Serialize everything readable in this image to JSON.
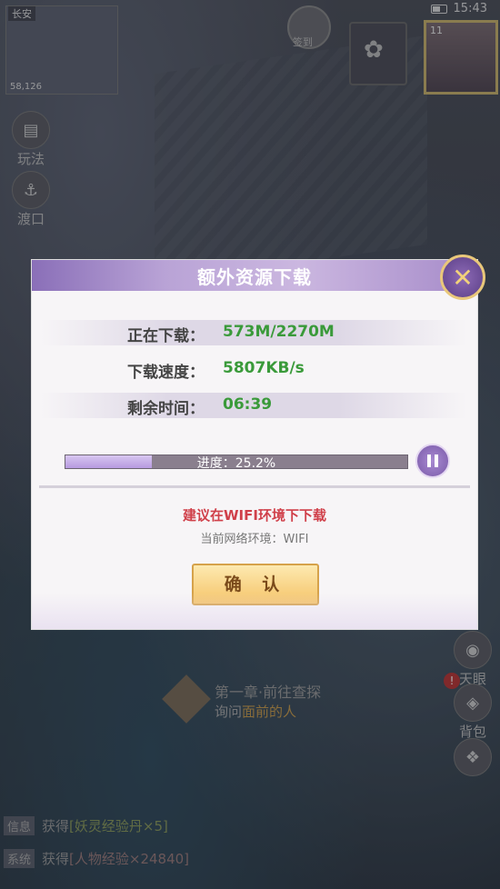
{
  "status_bar": {
    "time": "15:43"
  },
  "minimap": {
    "location": "长安",
    "coords": "58,126"
  },
  "player": {
    "level": "11"
  },
  "top_icons": {
    "event_label": "签到"
  },
  "side_buttons": [
    {
      "label": "玩法",
      "icon": "scroll-icon"
    },
    {
      "label": "渡口",
      "icon": "boat-icon"
    }
  ],
  "right_buttons": [
    {
      "label": "天眼",
      "icon": "eye-icon"
    },
    {
      "label": "背包",
      "icon": "bag-icon"
    }
  ],
  "quest": {
    "title": "第一章·前往查探",
    "sub_prefix": "询问",
    "sub_highlight": "面前的人"
  },
  "chat": [
    {
      "tag": "信息",
      "prefix": "获得",
      "item": "[妖灵经验丹×5]"
    },
    {
      "tag": "系统",
      "prefix": "获得",
      "item": "[人物经验×24840]"
    }
  ],
  "dialog": {
    "title": "额外资源下载",
    "rows": [
      {
        "label": "正在下载：",
        "value": "573M/2270M"
      },
      {
        "label": "下载速度：",
        "value": "5807KB/s"
      },
      {
        "label": "剩余时间：",
        "value": "06:39"
      }
    ],
    "progress": {
      "fraction": 0.252,
      "text": "进度：25.2%"
    },
    "suggestion": "建议在WIFI环境下下载",
    "network": "当前网络环境：WIFI",
    "confirm_label": "确 认"
  },
  "colors": {
    "accent": "#8a6fb8",
    "value_green": "#3a9a3a",
    "warning_red": "#d0404a",
    "button_gold": "#f5c469"
  }
}
